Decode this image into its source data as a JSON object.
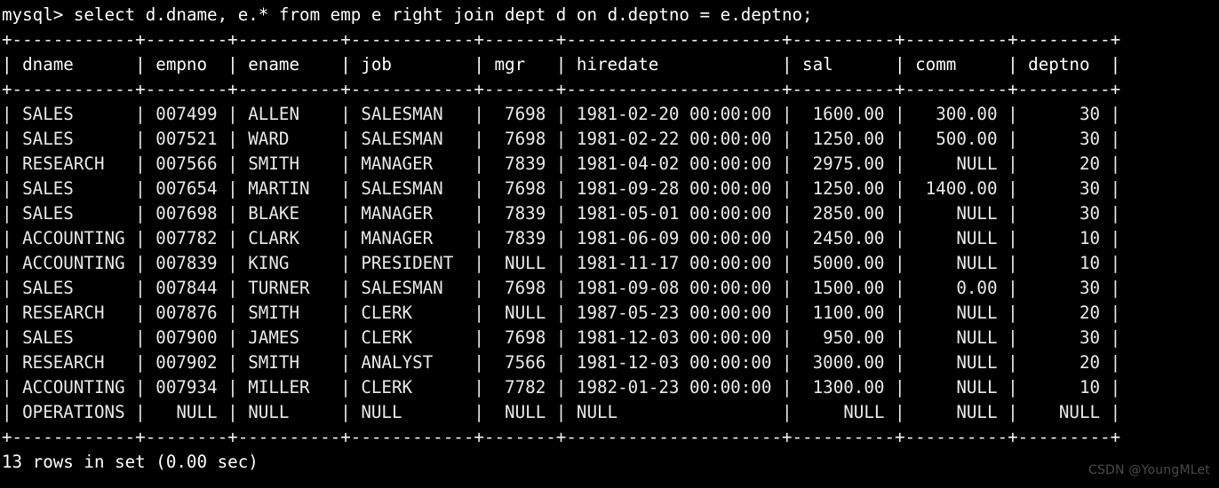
{
  "terminal": {
    "prompt": "mysql> ",
    "query": "select d.dname, e.* from emp e right join dept d on d.deptno = e.deptno;",
    "footer": "13 rows in set (0.00 sec)",
    "watermark": "CSDN @YoungMLet",
    "colors": {
      "background": "#000000",
      "foreground": "#e8e8e8",
      "watermark": "#4a4a4a"
    }
  },
  "table": {
    "columns": [
      {
        "name": "dname",
        "width": 10,
        "align": "left"
      },
      {
        "name": "empno",
        "width": 6,
        "align": "right"
      },
      {
        "name": "ename",
        "width": 8,
        "align": "left"
      },
      {
        "name": "job",
        "width": 10,
        "align": "left"
      },
      {
        "name": "mgr",
        "width": 5,
        "align": "right"
      },
      {
        "name": "hiredate",
        "width": 19,
        "align": "left"
      },
      {
        "name": "sal",
        "width": 8,
        "align": "right"
      },
      {
        "name": "comm",
        "width": 8,
        "align": "right"
      },
      {
        "name": "deptno",
        "width": 7,
        "align": "right"
      }
    ],
    "rows": [
      [
        "SALES",
        "007499",
        "ALLEN",
        "SALESMAN",
        "7698",
        "1981-02-20 00:00:00",
        "1600.00",
        "300.00",
        "30"
      ],
      [
        "SALES",
        "007521",
        "WARD",
        "SALESMAN",
        "7698",
        "1981-02-22 00:00:00",
        "1250.00",
        "500.00",
        "30"
      ],
      [
        "RESEARCH",
        "007566",
        "SMITH",
        "MANAGER",
        "7839",
        "1981-04-02 00:00:00",
        "2975.00",
        "NULL",
        "20"
      ],
      [
        "SALES",
        "007654",
        "MARTIN",
        "SALESMAN",
        "7698",
        "1981-09-28 00:00:00",
        "1250.00",
        "1400.00",
        "30"
      ],
      [
        "SALES",
        "007698",
        "BLAKE",
        "MANAGER",
        "7839",
        "1981-05-01 00:00:00",
        "2850.00",
        "NULL",
        "30"
      ],
      [
        "ACCOUNTING",
        "007782",
        "CLARK",
        "MANAGER",
        "7839",
        "1981-06-09 00:00:00",
        "2450.00",
        "NULL",
        "10"
      ],
      [
        "ACCOUNTING",
        "007839",
        "KING",
        "PRESIDENT",
        "NULL",
        "1981-11-17 00:00:00",
        "5000.00",
        "NULL",
        "10"
      ],
      [
        "SALES",
        "007844",
        "TURNER",
        "SALESMAN",
        "7698",
        "1981-09-08 00:00:00",
        "1500.00",
        "0.00",
        "30"
      ],
      [
        "RESEARCH",
        "007876",
        "SMITH",
        "CLERK",
        "NULL",
        "1987-05-23 00:00:00",
        "1100.00",
        "NULL",
        "20"
      ],
      [
        "SALES",
        "007900",
        "JAMES",
        "CLERK",
        "7698",
        "1981-12-03 00:00:00",
        "950.00",
        "NULL",
        "30"
      ],
      [
        "RESEARCH",
        "007902",
        "SMITH",
        "ANALYST",
        "7566",
        "1981-12-03 00:00:00",
        "3000.00",
        "NULL",
        "20"
      ],
      [
        "ACCOUNTING",
        "007934",
        "MILLER",
        "CLERK",
        "7782",
        "1982-01-23 00:00:00",
        "1300.00",
        "NULL",
        "10"
      ],
      [
        "OPERATIONS",
        "NULL",
        "NULL",
        "NULL",
        "NULL",
        "NULL",
        "NULL",
        "NULL",
        "NULL"
      ]
    ]
  }
}
